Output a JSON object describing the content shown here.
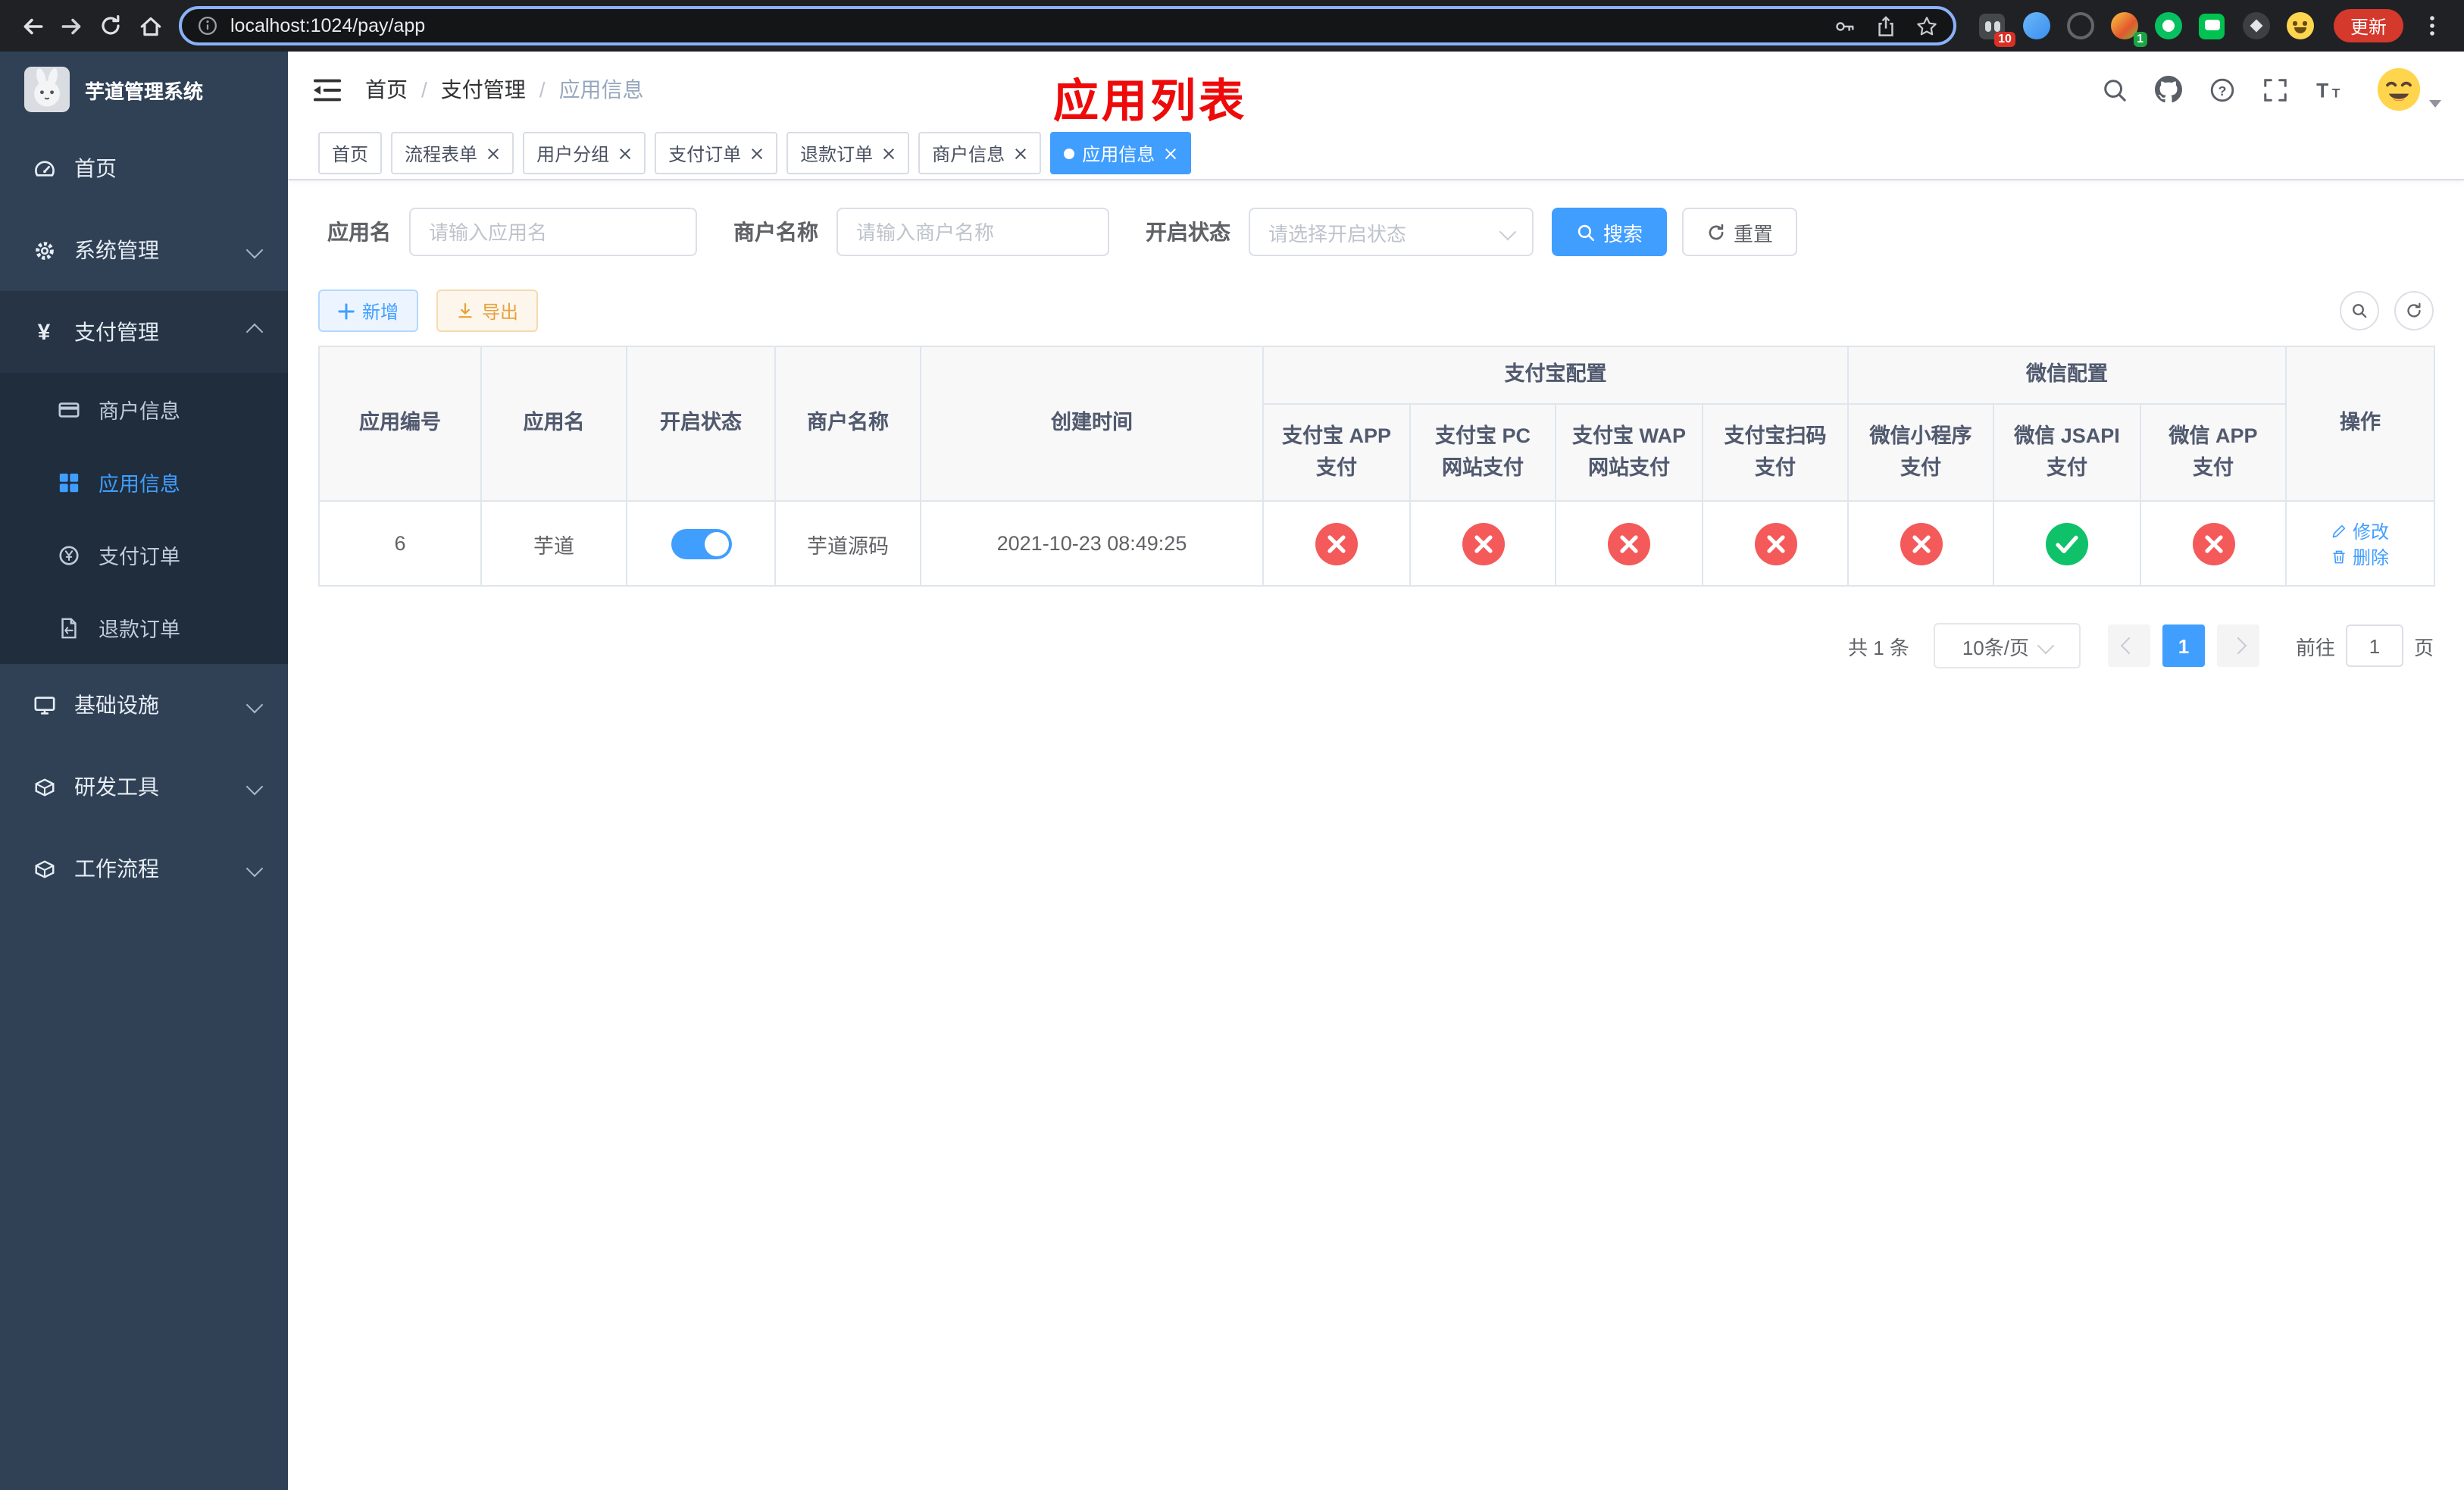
{
  "browser": {
    "url": "localhost:1024/pay/app",
    "update_label": "更新",
    "ext_badge_scripts": "10",
    "ext_badge_avatar": "1"
  },
  "sidebar": {
    "title": "芋道管理系统",
    "items": [
      {
        "label": "首页"
      },
      {
        "label": "系统管理"
      },
      {
        "label": "支付管理"
      },
      {
        "label": "商户信息"
      },
      {
        "label": "应用信息"
      },
      {
        "label": "支付订单"
      },
      {
        "label": "退款订单"
      },
      {
        "label": "基础设施"
      },
      {
        "label": "研发工具"
      },
      {
        "label": "工作流程"
      }
    ]
  },
  "header": {
    "breadcrumb": {
      "home": "首页",
      "section": "支付管理",
      "current": "应用信息",
      "separator": "/"
    },
    "annotation": "应用列表"
  },
  "tabs": [
    {
      "label": "首页"
    },
    {
      "label": "流程表单"
    },
    {
      "label": "用户分组"
    },
    {
      "label": "支付订单"
    },
    {
      "label": "退款订单"
    },
    {
      "label": "商户信息"
    },
    {
      "label": "应用信息"
    }
  ],
  "filters": {
    "app_name_label": "应用名",
    "app_name_placeholder": "请输入应用名",
    "merchant_label": "商户名称",
    "merchant_placeholder": "请输入商户名称",
    "status_label": "开启状态",
    "status_placeholder": "请选择开启状态",
    "search_label": "搜索",
    "reset_label": "重置"
  },
  "toolbar": {
    "add_label": "新增",
    "export_label": "导出"
  },
  "table": {
    "headers": {
      "app_id": "应用编号",
      "app_name": "应用名",
      "status": "开启状态",
      "merchant": "商户名称",
      "created": "创建时间",
      "alipay_group": "支付宝配置",
      "wechat_group": "微信配置",
      "alipay_app": "支付宝 APP 支付",
      "alipay_pc": "支付宝 PC 网站支付",
      "alipay_wap": "支付宝 WAP 网站支付",
      "alipay_qr": "支付宝扫码支付",
      "wx_mini": "微信小程序支付",
      "wx_jsapi": "微信 JSAPI 支付",
      "wx_app": "微信 APP 支付",
      "actions": "操作"
    },
    "rows": [
      {
        "app_id": "6",
        "app_name": "芋道",
        "enabled": "on",
        "merchant": "芋道源码",
        "created": "2021-10-23 08:49:25",
        "alipay_app": "fail",
        "alipay_pc": "fail",
        "alipay_wap": "fail",
        "alipay_qr": "fail",
        "wx_mini": "fail",
        "wx_jsapi": "pass",
        "wx_app": "fail"
      }
    ],
    "actions": {
      "edit": "修改",
      "delete": "删除"
    }
  },
  "pagination": {
    "total": "共 1 条",
    "size": "10条/页",
    "page": "1",
    "goto_label": "前往",
    "goto_value": "1",
    "unit_label": "页"
  },
  "icons": {
    "payment_glyph": "¥"
  },
  "colors": {
    "accent": "#409eff",
    "pass_green": "#0fc269",
    "fail_red": "#f45a5a",
    "annotation_red": "#ee0a0a",
    "sidebar_bg": "#304156"
  }
}
